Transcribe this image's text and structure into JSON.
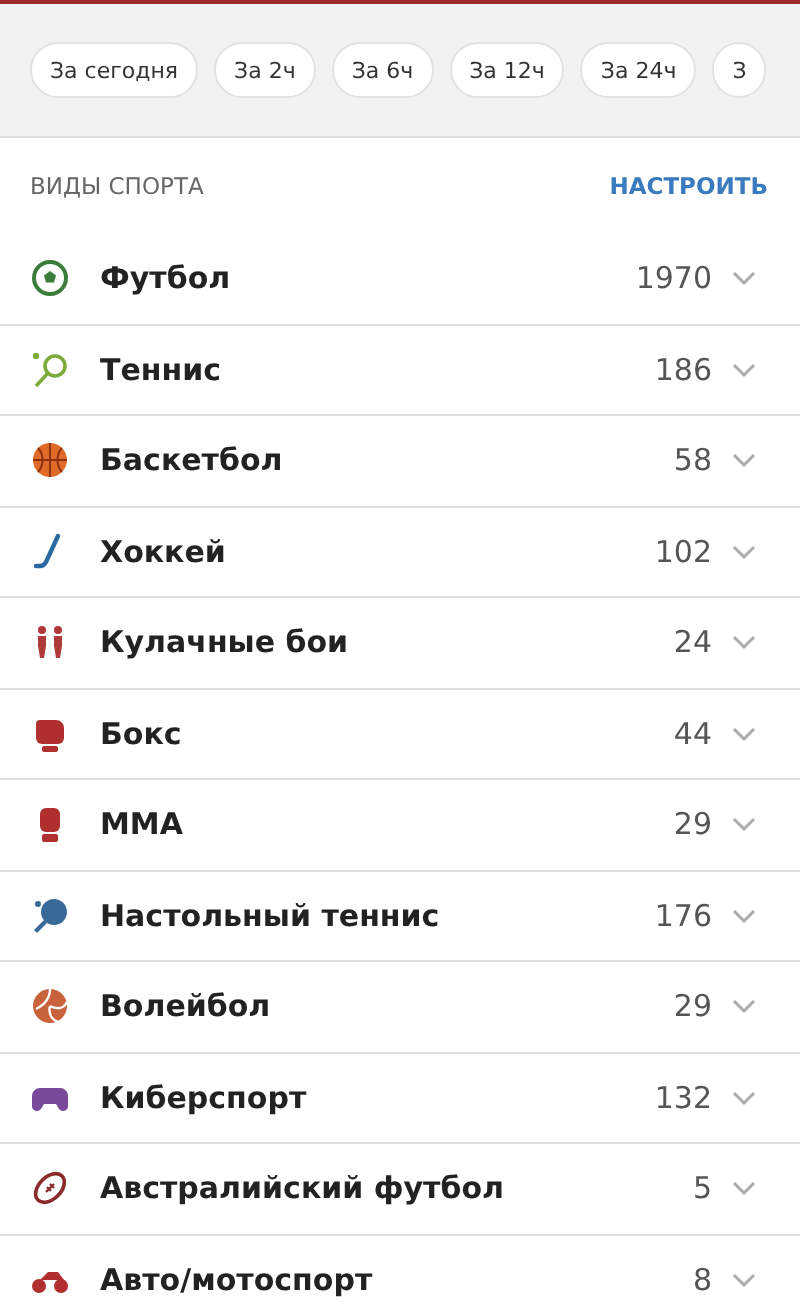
{
  "filters": [
    {
      "label": "За сегодня"
    },
    {
      "label": "За 2ч"
    },
    {
      "label": "За 6ч"
    },
    {
      "label": "За 12ч"
    },
    {
      "label": "За 24ч"
    },
    {
      "label": "З"
    }
  ],
  "section": {
    "title": "ВИДЫ СПОРТА",
    "action": "НАСТРОИТЬ"
  },
  "sports": [
    {
      "kind": "football",
      "name": "Футбол",
      "count": "1970"
    },
    {
      "kind": "tennis",
      "name": "Теннис",
      "count": "186"
    },
    {
      "kind": "basketball",
      "name": "Баскетбол",
      "count": "58"
    },
    {
      "kind": "hockey",
      "name": "Хоккей",
      "count": "102"
    },
    {
      "kind": "fight",
      "name": "Кулачные бои",
      "count": "24"
    },
    {
      "kind": "boxing",
      "name": "Бокс",
      "count": "44"
    },
    {
      "kind": "mma",
      "name": "ММА",
      "count": "29"
    },
    {
      "kind": "pingpong",
      "name": "Настольный теннис",
      "count": "176"
    },
    {
      "kind": "volleyball",
      "name": "Волейбол",
      "count": "29"
    },
    {
      "kind": "esports",
      "name": "Киберспорт",
      "count": "132"
    },
    {
      "kind": "rugby",
      "name": "Австралийский футбол",
      "count": "5"
    },
    {
      "kind": "moto",
      "name": "Авто/мотоспорт",
      "count": "8"
    }
  ]
}
